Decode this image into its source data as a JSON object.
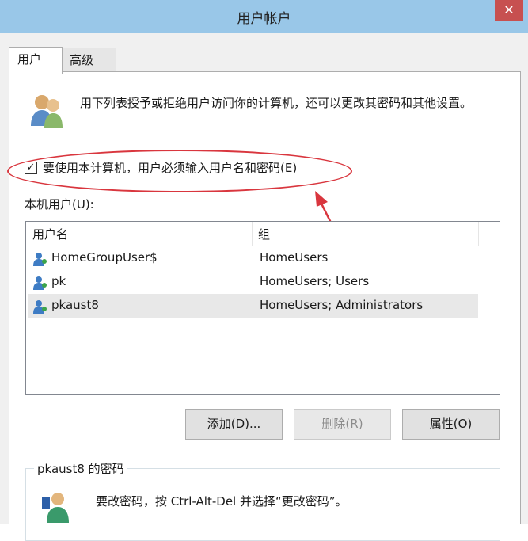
{
  "window": {
    "title": "用户帐户",
    "close_label": "✕"
  },
  "tabs": [
    {
      "label": "用户",
      "active": true
    },
    {
      "label": "高级",
      "active": false
    }
  ],
  "intro_text": "用下列表授予或拒绝用户访问你的计算机，还可以更改其密码和其他设置。",
  "require_login": {
    "label": "要使用本计算机，用户必须输入用户名和密码(E)",
    "checked": true,
    "check_glyph": "✓"
  },
  "users_section": {
    "label": "本机用户(U):",
    "columns": [
      "用户名",
      "组"
    ],
    "rows": [
      {
        "name": "HomeGroupUser$",
        "group": "HomeUsers",
        "selected": false
      },
      {
        "name": "pk",
        "group": "HomeUsers; Users",
        "selected": false
      },
      {
        "name": "pkaust8",
        "group": "HomeUsers; Administrators",
        "selected": true
      }
    ]
  },
  "buttons": {
    "add": "添加(D)...",
    "remove": "删除(R)",
    "properties": "属性(O)"
  },
  "password_section": {
    "title": "pkaust8 的密码",
    "text": "要改密码，按 Ctrl-Alt-Del 并选择“更改密码”。"
  },
  "colors": {
    "titlebar": "#99c7e8",
    "close": "#c75050",
    "annotation": "#d9363e"
  },
  "icons": [
    "users-icon",
    "user-icon",
    "key-user-icon",
    "checkbox",
    "annotation-arrow"
  ]
}
